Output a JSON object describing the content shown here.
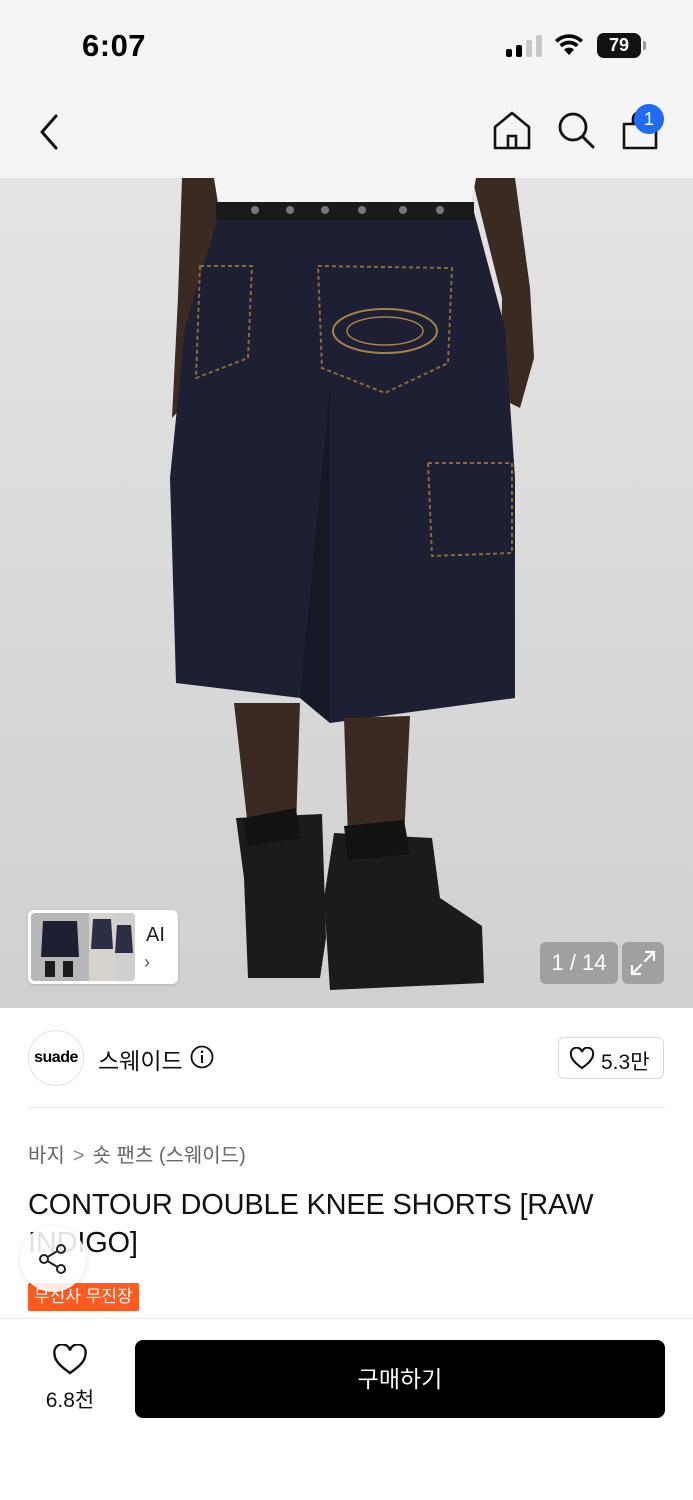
{
  "status_bar": {
    "time": "6:07",
    "battery": "79"
  },
  "nav": {
    "cart_count": "1",
    "icons": [
      "chevron-left-icon",
      "home-icon",
      "search-icon",
      "shopping-bag-icon"
    ]
  },
  "gallery": {
    "counter": "1 / 14",
    "thumb_label": "AI",
    "thumb_chevron": "›"
  },
  "brand": {
    "logo_text": "suade",
    "name": "스웨이드",
    "likes": "5.3만"
  },
  "product": {
    "breadcrumb": [
      "바지",
      "숏 팬츠 (스웨이드)"
    ],
    "breadcrumb_sep": ">",
    "title": "CONTOUR DOUBLE KNEE SHORTS [RAW INDIGO]",
    "tag": "무신사 무진장"
  },
  "bottom_bar": {
    "like_count": "6.8천",
    "buy_label": "구매하기"
  },
  "colors": {
    "accent_blue": "#1e6cf2",
    "tag_orange": "#ff5a1f",
    "buy_button": "#000000"
  }
}
